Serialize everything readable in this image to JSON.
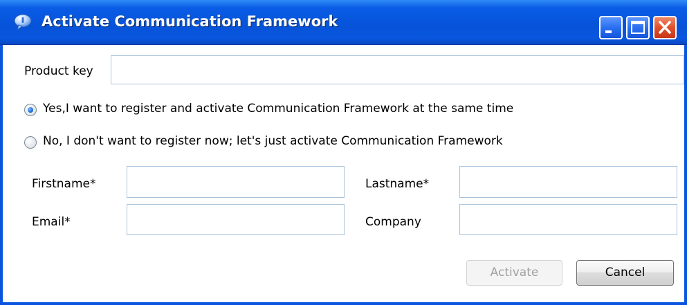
{
  "window": {
    "title": "Activate Communication Framework",
    "controls": {
      "minimize": "minimize-icon",
      "maximize": "maximize-icon",
      "close": "close-icon"
    }
  },
  "product_key": {
    "label": "Product key",
    "value": ""
  },
  "registration": {
    "options": [
      {
        "label": "Yes,I want to register and activate Communication Framework at the same time",
        "selected": true
      },
      {
        "label": "No, I don't want to register now; let's just activate Communication Framework",
        "selected": false
      }
    ]
  },
  "form": {
    "firstname": {
      "label": "Firstname*",
      "value": ""
    },
    "lastname": {
      "label": "Lastname*",
      "value": ""
    },
    "email": {
      "label": "Email*",
      "value": ""
    },
    "company": {
      "label": "Company",
      "value": ""
    }
  },
  "buttons": {
    "activate": {
      "label": "Activate",
      "enabled": false
    },
    "cancel": {
      "label": "Cancel",
      "enabled": true
    }
  },
  "colors": {
    "titlebar": "#0653d8",
    "close_button": "#e0502a",
    "field_border": "#a9c3db"
  }
}
